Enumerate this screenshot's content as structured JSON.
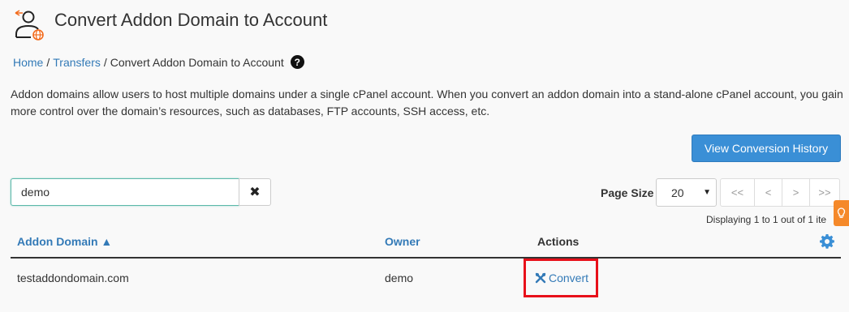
{
  "page": {
    "title": "Convert Addon Domain to Account"
  },
  "breadcrumb": {
    "home": "Home",
    "transfers": "Transfers",
    "current": "Convert Addon Domain to Account",
    "sep": "/"
  },
  "description": "Addon domains allow users to host multiple domains under a single cPanel account. When you convert an addon domain into a stand-alone cPanel account, you gain more control over the domain’s resources, such as databases, FTP accounts, SSH access, etc.",
  "toolbar": {
    "history_button": "View Conversion History",
    "search_value": "demo",
    "page_size_label": "Page Size",
    "page_size_value": "20",
    "pager": {
      "first": "<<",
      "prev": "<",
      "next": ">",
      "last": ">>"
    },
    "displaying": "Displaying 1 to 1 out of 1 ite"
  },
  "table": {
    "headers": {
      "domain": "Addon Domain ▲",
      "owner": "Owner",
      "actions": "Actions"
    },
    "rows": [
      {
        "domain": "testaddondomain.com",
        "owner": "demo",
        "action": "Convert"
      }
    ]
  },
  "colors": {
    "link": "#337ab7",
    "primary_button": "#3a8fd6",
    "highlight": "#e8101a",
    "side_tab": "#f5892a"
  },
  "icons": [
    "page-icon",
    "help-icon",
    "clear-icon",
    "gear-icon",
    "wrench-icon",
    "lightbulb-icon"
  ]
}
